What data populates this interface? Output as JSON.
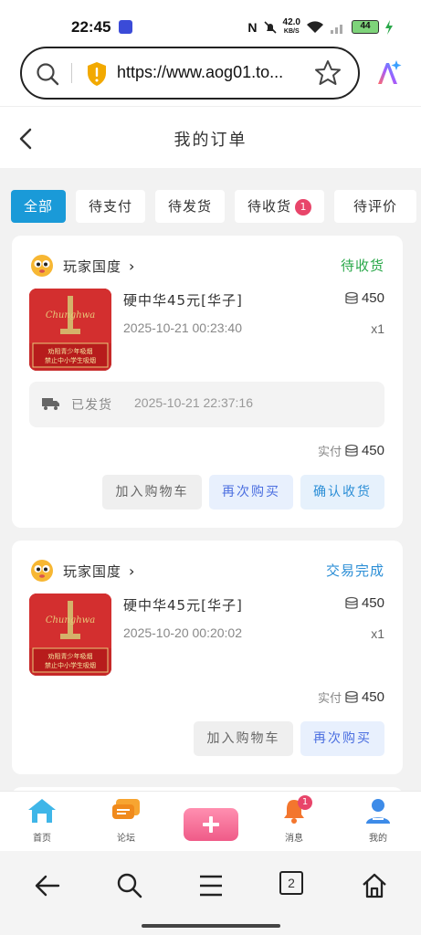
{
  "status_bar": {
    "time": "22:45",
    "net_speed": "42.0",
    "net_unit": "KB/S",
    "battery": "44"
  },
  "browser": {
    "url": "https://www.aog01.to..."
  },
  "header": {
    "title": "我的订单"
  },
  "tabs": [
    {
      "label": "全部",
      "active": true
    },
    {
      "label": "待支付"
    },
    {
      "label": "待发货"
    },
    {
      "label": "待收货",
      "badge": "1"
    },
    {
      "label": "待评价"
    }
  ],
  "orders": [
    {
      "shop": "玩家国度",
      "status": "待收货",
      "status_color": "#2aa84a",
      "product": "硬中华45元[华子]",
      "date": "2025-10-21 00:23:40",
      "price": "450",
      "qty": "x1",
      "shipping_label": "已发货",
      "shipping_time": "2025-10-21 22:37:16",
      "paid_label": "实付",
      "paid_amount": "450",
      "buttons": [
        "加入购物车",
        "再次购买",
        "确认收货"
      ]
    },
    {
      "shop": "玩家国度",
      "status": "交易完成",
      "status_color": "#2b8ed6",
      "product": "硬中华45元[华子]",
      "date": "2025-10-20 00:20:02",
      "price": "450",
      "qty": "x1",
      "paid_label": "实付",
      "paid_amount": "450",
      "buttons": [
        "加入购物车",
        "再次购买"
      ]
    }
  ],
  "pack": {
    "brand": "Chunghwa",
    "warning_1": "劝阻青少年吸烟",
    "warning_2": "禁止中小学生吸烟"
  },
  "bottom_nav": [
    {
      "label": "首页"
    },
    {
      "label": "论坛"
    },
    {
      "label": ""
    },
    {
      "label": "消息",
      "badge": "1"
    },
    {
      "label": "我的"
    }
  ],
  "android_nav": {
    "tabs_count": "2"
  }
}
